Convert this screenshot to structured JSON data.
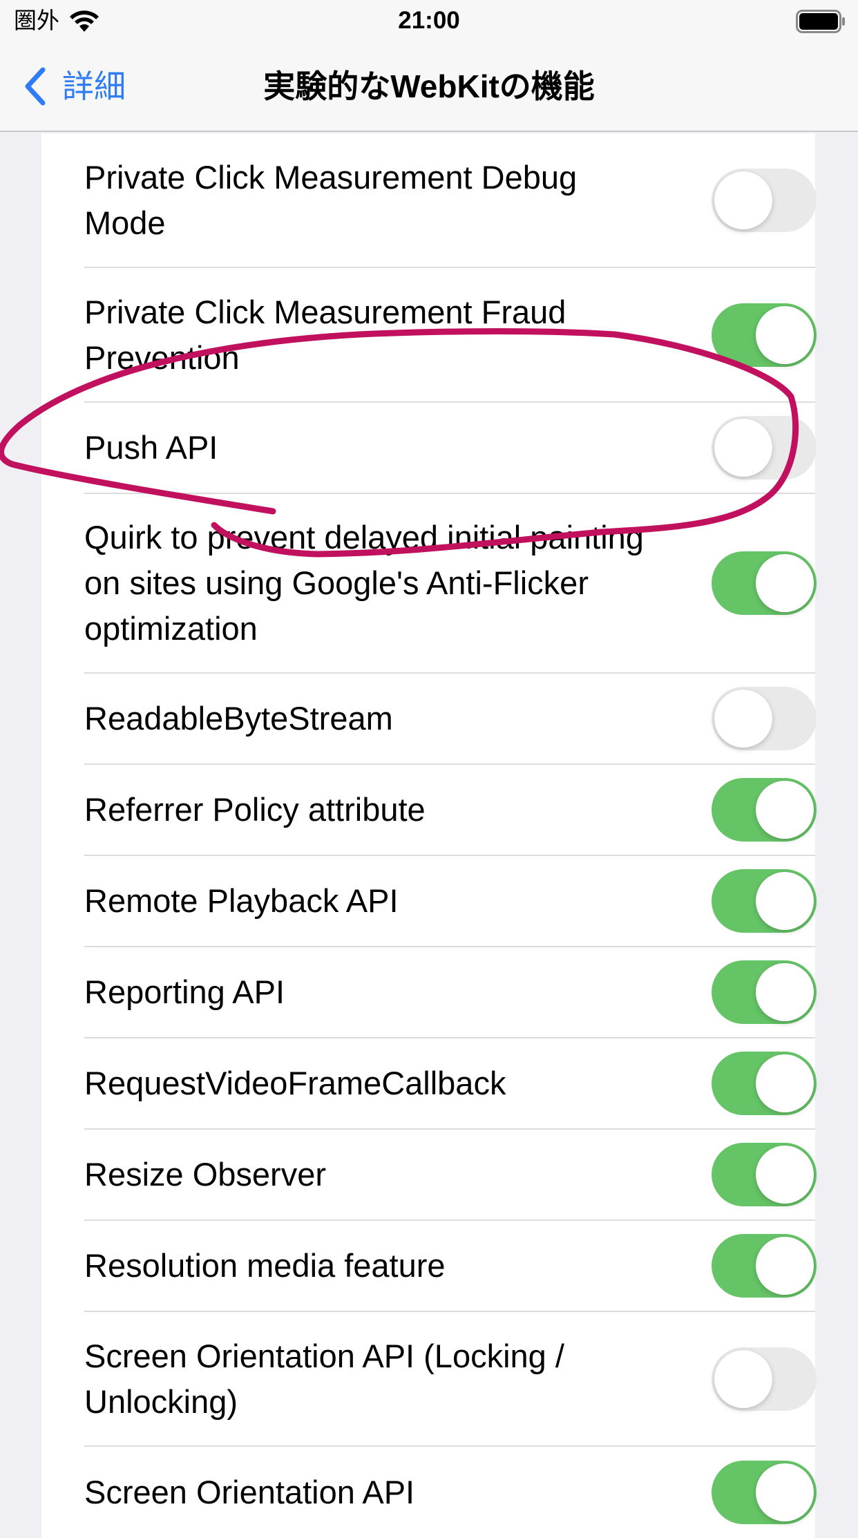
{
  "status_bar": {
    "carrier": "圏外",
    "time": "21:00",
    "icons": [
      "wifi-icon",
      "battery-icon"
    ]
  },
  "nav": {
    "back_label": "詳細",
    "title": "実験的なWebKitの機能",
    "back_icon": "chevron-left-icon"
  },
  "colors": {
    "accent": "#2f7cf6",
    "toggle_on": "#65c466",
    "toggle_off": "#e9e9ea",
    "annotation": "#c0105e"
  },
  "rows": [
    {
      "label": "Private Click Measurement Debug Mode",
      "on": false
    },
    {
      "label": "Private Click Measurement Fraud Prevention",
      "on": true
    },
    {
      "label": "Push API",
      "on": false
    },
    {
      "label": "Quirk to prevent delayed initial painting on sites using Google's Anti-Flicker optimization",
      "on": true
    },
    {
      "label": "ReadableByteStream",
      "on": false
    },
    {
      "label": "Referrer Policy attribute",
      "on": true
    },
    {
      "label": "Remote Playback API",
      "on": true
    },
    {
      "label": "Reporting API",
      "on": true
    },
    {
      "label": "RequestVideoFrameCallback",
      "on": true
    },
    {
      "label": "Resize Observer",
      "on": true
    },
    {
      "label": "Resolution media feature",
      "on": true
    },
    {
      "label": "Screen Orientation API (Locking / Unlocking)",
      "on": false
    },
    {
      "label": "Screen Orientation API",
      "on": true
    }
  ]
}
